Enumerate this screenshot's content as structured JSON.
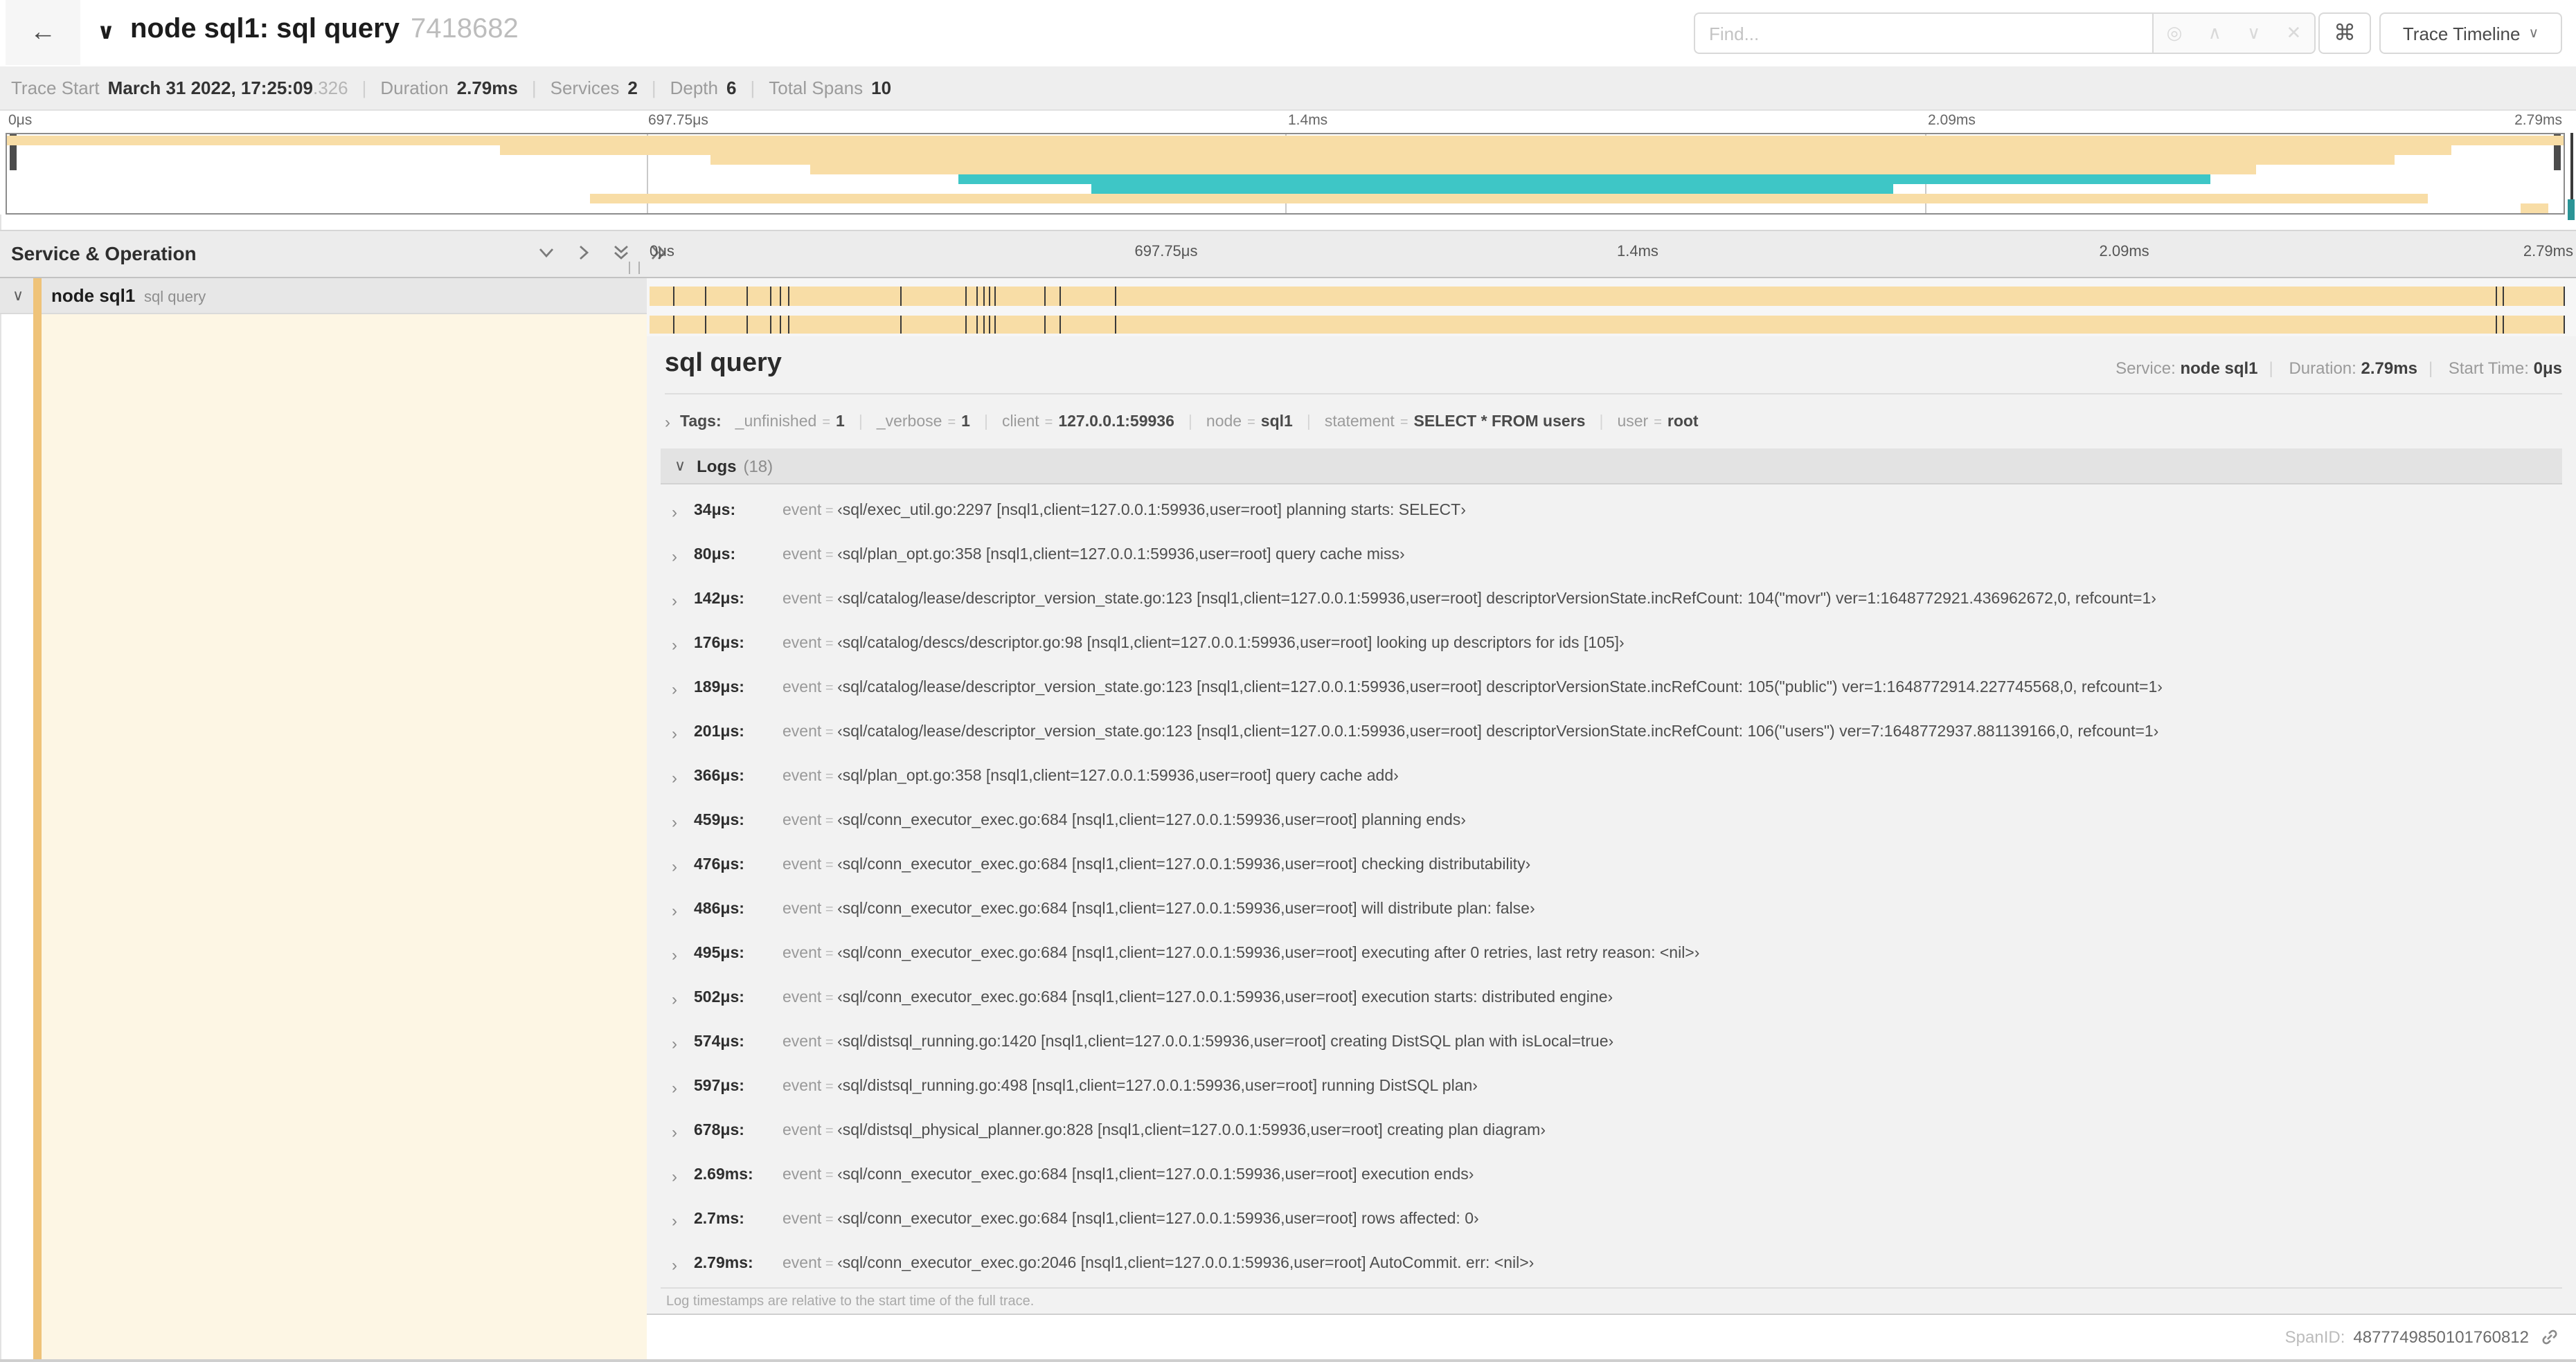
{
  "header": {
    "back_label": "back",
    "collapse_chevron": "∨",
    "title": "node sql1: sql query",
    "trace_id": "7418682",
    "find_placeholder": "Find...",
    "cmd_button": "⌘",
    "view_button": "Trace Timeline",
    "view_button_caret": "∨"
  },
  "trace_meta": {
    "items": [
      {
        "label": "Trace Start",
        "value": "March 31 2022, 17:25:09",
        "suffix": ".326"
      },
      {
        "label": "Duration",
        "value": "2.79ms",
        "suffix": ""
      },
      {
        "label": "Services",
        "value": "2",
        "suffix": ""
      },
      {
        "label": "Depth",
        "value": "6",
        "suffix": ""
      },
      {
        "label": "Total Spans",
        "value": "10",
        "suffix": ""
      }
    ]
  },
  "time_ticks": [
    {
      "label": "0μs",
      "pct": 0
    },
    {
      "label": "697.75μs",
      "pct": 25
    },
    {
      "label": "1.4ms",
      "pct": 50
    },
    {
      "label": "2.09ms",
      "pct": 75
    },
    {
      "label": "2.79ms",
      "pct": 100
    }
  ],
  "minimap": {
    "colors": {
      "tan": "#f8dda6",
      "teal": "#3ec6c6"
    },
    "spans": [
      {
        "row": 0,
        "start": 0,
        "end": 100,
        "color": "tan"
      },
      {
        "row": 1,
        "start": 19.3,
        "end": 95.6,
        "color": "tan"
      },
      {
        "row": 2,
        "start": 27.5,
        "end": 93.4,
        "color": "tan"
      },
      {
        "row": 3,
        "start": 31.4,
        "end": 88.0,
        "color": "tan"
      },
      {
        "row": 4,
        "start": 37.2,
        "end": 86.2,
        "color": "teal"
      },
      {
        "row": 5,
        "start": 42.4,
        "end": 73.8,
        "color": "teal"
      },
      {
        "row": 6,
        "start": 22.8,
        "end": 94.7,
        "color": "tan"
      },
      {
        "row": 7,
        "start": 98.3,
        "end": 99.4,
        "color": "tan"
      }
    ]
  },
  "timeline_header": {
    "title": "Service & Operation"
  },
  "span_row": {
    "service": "node sql1",
    "operation": "sql query",
    "chevron": "∨"
  },
  "detail": {
    "title": "sql query",
    "service_label": "Service:",
    "service_value": "node sql1",
    "duration_label": "Duration:",
    "duration_value": "2.79ms",
    "start_label": "Start Time:",
    "start_value": "0μs",
    "tags_label": "Tags:",
    "tags": [
      {
        "key": "_unfinished",
        "value": "1"
      },
      {
        "key": "_verbose",
        "value": "1"
      },
      {
        "key": "client",
        "value": "127.0.0.1:59936"
      },
      {
        "key": "node",
        "value": "sql1"
      },
      {
        "key": "statement",
        "value": "SELECT * FROM users"
      },
      {
        "key": "user",
        "value": "root"
      }
    ],
    "logs_title": "Logs",
    "logs_count": "(18)",
    "duration_us": 2790,
    "logs": [
      {
        "time": "34μs:",
        "t_us": 34,
        "field": "event",
        "value": "‹sql/exec_util.go:2297 [nsql1,client=127.0.0.1:59936,user=root] planning starts: SELECT›"
      },
      {
        "time": "80μs:",
        "t_us": 80,
        "field": "event",
        "value": "‹sql/plan_opt.go:358 [nsql1,client=127.0.0.1:59936,user=root] query cache miss›"
      },
      {
        "time": "142μs:",
        "t_us": 142,
        "field": "event",
        "value": "‹sql/catalog/lease/descriptor_version_state.go:123 [nsql1,client=127.0.0.1:59936,user=root] descriptorVersionState.incRefCount: 104(\"movr\") ver=1:1648772921.436962672,0, refcount=1›"
      },
      {
        "time": "176μs:",
        "t_us": 176,
        "field": "event",
        "value": "‹sql/catalog/descs/descriptor.go:98 [nsql1,client=127.0.0.1:59936,user=root] looking up descriptors for ids [105]›"
      },
      {
        "time": "189μs:",
        "t_us": 189,
        "field": "event",
        "value": "‹sql/catalog/lease/descriptor_version_state.go:123 [nsql1,client=127.0.0.1:59936,user=root] descriptorVersionState.incRefCount: 105(\"public\") ver=1:1648772914.227745568,0, refcount=1›"
      },
      {
        "time": "201μs:",
        "t_us": 201,
        "field": "event",
        "value": "‹sql/catalog/lease/descriptor_version_state.go:123 [nsql1,client=127.0.0.1:59936,user=root] descriptorVersionState.incRefCount: 106(\"users\") ver=7:1648772937.881139166,0, refcount=1›"
      },
      {
        "time": "366μs:",
        "t_us": 366,
        "field": "event",
        "value": "‹sql/plan_opt.go:358 [nsql1,client=127.0.0.1:59936,user=root] query cache add›"
      },
      {
        "time": "459μs:",
        "t_us": 459,
        "field": "event",
        "value": "‹sql/conn_executor_exec.go:684 [nsql1,client=127.0.0.1:59936,user=root] planning ends›"
      },
      {
        "time": "476μs:",
        "t_us": 476,
        "field": "event",
        "value": "‹sql/conn_executor_exec.go:684 [nsql1,client=127.0.0.1:59936,user=root] checking distributability›"
      },
      {
        "time": "486μs:",
        "t_us": 486,
        "field": "event",
        "value": "‹sql/conn_executor_exec.go:684 [nsql1,client=127.0.0.1:59936,user=root] will distribute plan: false›"
      },
      {
        "time": "495μs:",
        "t_us": 495,
        "field": "event",
        "value": "‹sql/conn_executor_exec.go:684 [nsql1,client=127.0.0.1:59936,user=root] executing after 0 retries, last retry reason: <nil>›"
      },
      {
        "time": "502μs:",
        "t_us": 502,
        "field": "event",
        "value": "‹sql/conn_executor_exec.go:684 [nsql1,client=127.0.0.1:59936,user=root] execution starts: distributed engine›"
      },
      {
        "time": "574μs:",
        "t_us": 574,
        "field": "event",
        "value": "‹sql/distsql_running.go:1420 [nsql1,client=127.0.0.1:59936,user=root] creating DistSQL plan with isLocal=true›"
      },
      {
        "time": "597μs:",
        "t_us": 597,
        "field": "event",
        "value": "‹sql/distsql_running.go:498 [nsql1,client=127.0.0.1:59936,user=root] running DistSQL plan›"
      },
      {
        "time": "678μs:",
        "t_us": 678,
        "field": "event",
        "value": "‹sql/distsql_physical_planner.go:828 [nsql1,client=127.0.0.1:59936,user=root] creating plan diagram›"
      },
      {
        "time": "2.69ms:",
        "t_us": 2690,
        "field": "event",
        "value": "‹sql/conn_executor_exec.go:684 [nsql1,client=127.0.0.1:59936,user=root] execution ends›"
      },
      {
        "time": "2.7ms:",
        "t_us": 2700,
        "field": "event",
        "value": "‹sql/conn_executor_exec.go:684 [nsql1,client=127.0.0.1:59936,user=root] rows affected: 0›"
      },
      {
        "time": "2.79ms:",
        "t_us": 2790,
        "field": "event",
        "value": "‹sql/conn_executor_exec.go:2046 [nsql1,client=127.0.0.1:59936,user=root] AutoCommit. err: <nil>›"
      }
    ],
    "footer_note": "Log timestamps are relative to the start time of the full trace.",
    "span_id_label": "SpanID:",
    "span_id": "4877749850101760812"
  }
}
